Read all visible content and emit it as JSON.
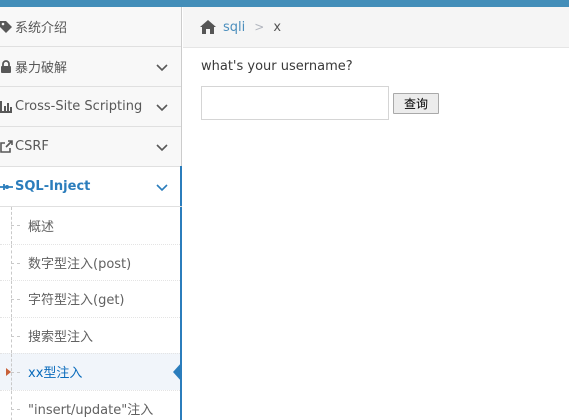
{
  "colors": {
    "topbar": "#438eb9",
    "sidebar_bg": "#f8f8f8",
    "accent_blue": "#2b7dbc",
    "active_caret": "#c86139"
  },
  "sidebar": {
    "items": [
      {
        "label": "系统介绍",
        "icon": "tag-icon"
      },
      {
        "label": "暴力破解",
        "icon": "lock-icon",
        "expandable": true
      },
      {
        "label": "Cross-Site Scripting",
        "icon": "bar-chart-icon",
        "expandable": true
      },
      {
        "label": "CSRF",
        "icon": "external-link-icon",
        "expandable": true
      },
      {
        "label": "SQL-Inject",
        "icon": "crosshair-icon",
        "expandable": true,
        "active": true
      }
    ],
    "submenu": [
      {
        "label": "概述"
      },
      {
        "label": "数字型注入(post)"
      },
      {
        "label": "字符型注入(get)"
      },
      {
        "label": "搜索型注入"
      },
      {
        "label": "xx型注入",
        "active": true
      },
      {
        "label": "\"insert/update\"注入"
      }
    ]
  },
  "breadcrumb": {
    "link": "sqli",
    "separator": ">",
    "current": "x"
  },
  "form": {
    "question": "what's your username?",
    "username_value": "",
    "button_label": "查询"
  }
}
